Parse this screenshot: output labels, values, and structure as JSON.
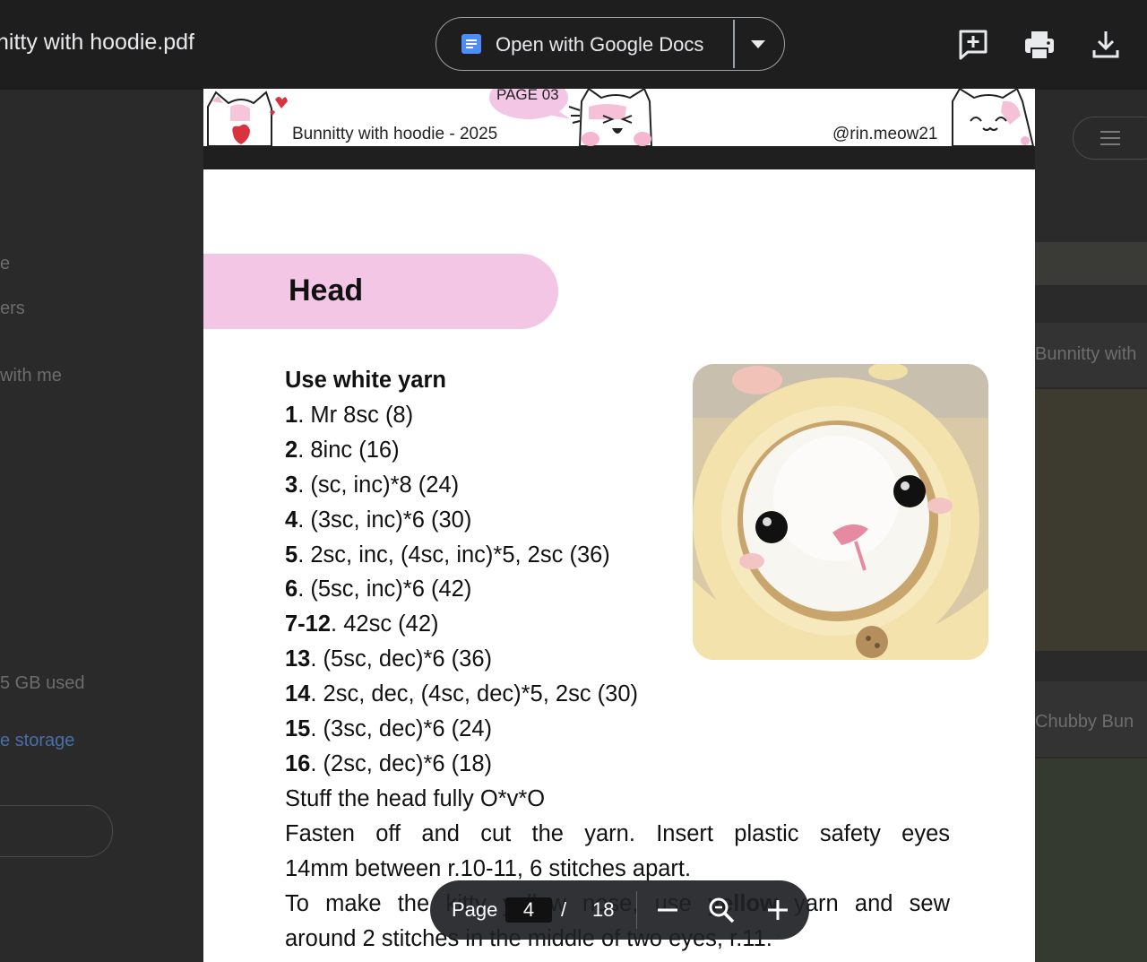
{
  "header": {
    "filename": "nitty with hoodie.pdf",
    "open_with_label": "Open with Google Docs"
  },
  "background": {
    "left_items": [
      "e",
      "ers",
      "with me",
      "5 GB used",
      "e storage"
    ],
    "right_items": [
      "Bunnitty with",
      "Chubby Bun"
    ]
  },
  "strip": {
    "page_tag": "PAGE 03",
    "title": "Bunnitty with hoodie - 2025",
    "handle": "@rin.meow21"
  },
  "page": {
    "section_title": "Head",
    "yarn_note": "Use white yarn",
    "rounds": [
      {
        "num": "1",
        "text": ". Mr 8sc (8)"
      },
      {
        "num": "2",
        "text": ". 8inc (16)"
      },
      {
        "num": "3",
        "text": ". (sc, inc)*8 (24)"
      },
      {
        "num": "4",
        "text": ". (3sc, inc)*6 (30)"
      },
      {
        "num": "5",
        "text": ". 2sc, inc, (4sc, inc)*5, 2sc (36)"
      },
      {
        "num": "6",
        "text": ". (5sc, inc)*6 (42)"
      },
      {
        "num": "7-12",
        "text": ". 42sc (42)"
      },
      {
        "num": "13",
        "text": ". (5sc, dec)*6 (36)"
      },
      {
        "num": "14",
        "text": ". 2sc, dec, (4sc, dec)*5, 2sc (30)"
      },
      {
        "num": "15",
        "text": ". (3sc, dec)*6 (24)"
      },
      {
        "num": "16",
        "text": ". (2sc, dec)*6 (18)"
      }
    ],
    "stuff_note": "Stuff the head fully O*v*O",
    "fasten_line1": "Fasten off and cut the yarn. Insert plastic safety eyes",
    "fasten_line2": "14mm between r.10-11, 6 stitches apart.",
    "nose_line1_a": "To make the kitty yellow nose, use ",
    "nose_line1_b": "yellow",
    "nose_line1_c": " yarn and sew",
    "nose_line2": "around 2 stitches in the middle of two eyes, r.11."
  },
  "pager": {
    "label": "Page",
    "current": "4",
    "separator": "/",
    "total": "18"
  },
  "icons": {
    "docs": "google-docs-icon",
    "comment": "add-comment-icon",
    "print": "print-icon",
    "download": "download-icon",
    "zoom_out": "minus-icon",
    "zoom": "zoom-icon",
    "zoom_in": "plus-icon"
  }
}
